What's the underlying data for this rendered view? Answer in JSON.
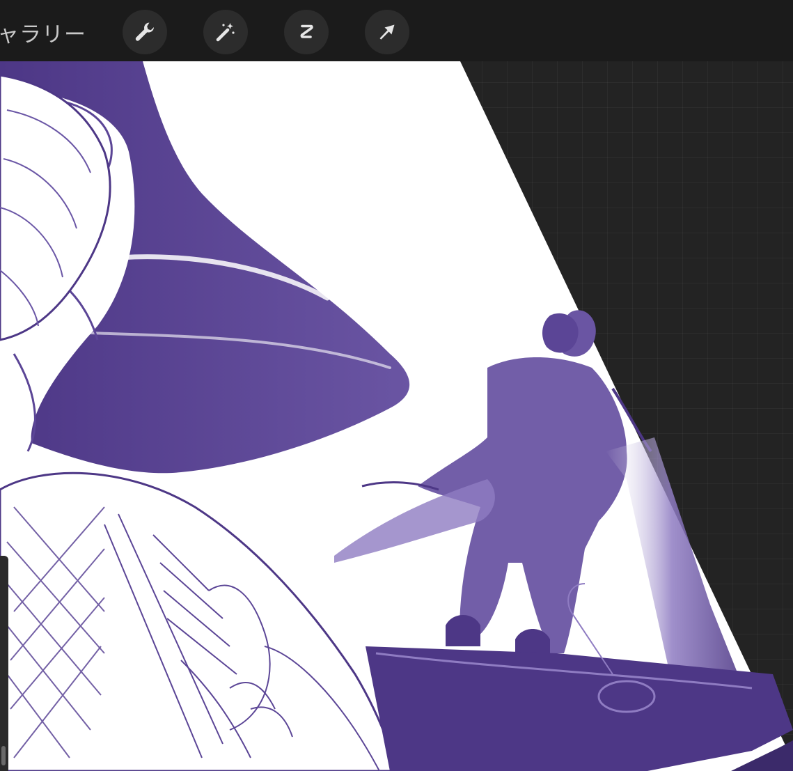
{
  "toolbar": {
    "gallery_label": "ャラリー",
    "tools": [
      {
        "name": "wrench-icon",
        "label": "actions"
      },
      {
        "name": "magic-wand-icon",
        "label": "adjustments"
      },
      {
        "name": "selection-s-icon",
        "label": "selection"
      },
      {
        "name": "transform-arrow-icon",
        "label": "transform"
      }
    ]
  },
  "colors": {
    "toolbar_bg": "#1b1b1b",
    "tool_button_bg": "#2c2c2c",
    "icon_color": "#e6e6e6",
    "workspace_bg": "#232323",
    "ink_purple": "#4d3786",
    "paper": "#ffffff"
  }
}
